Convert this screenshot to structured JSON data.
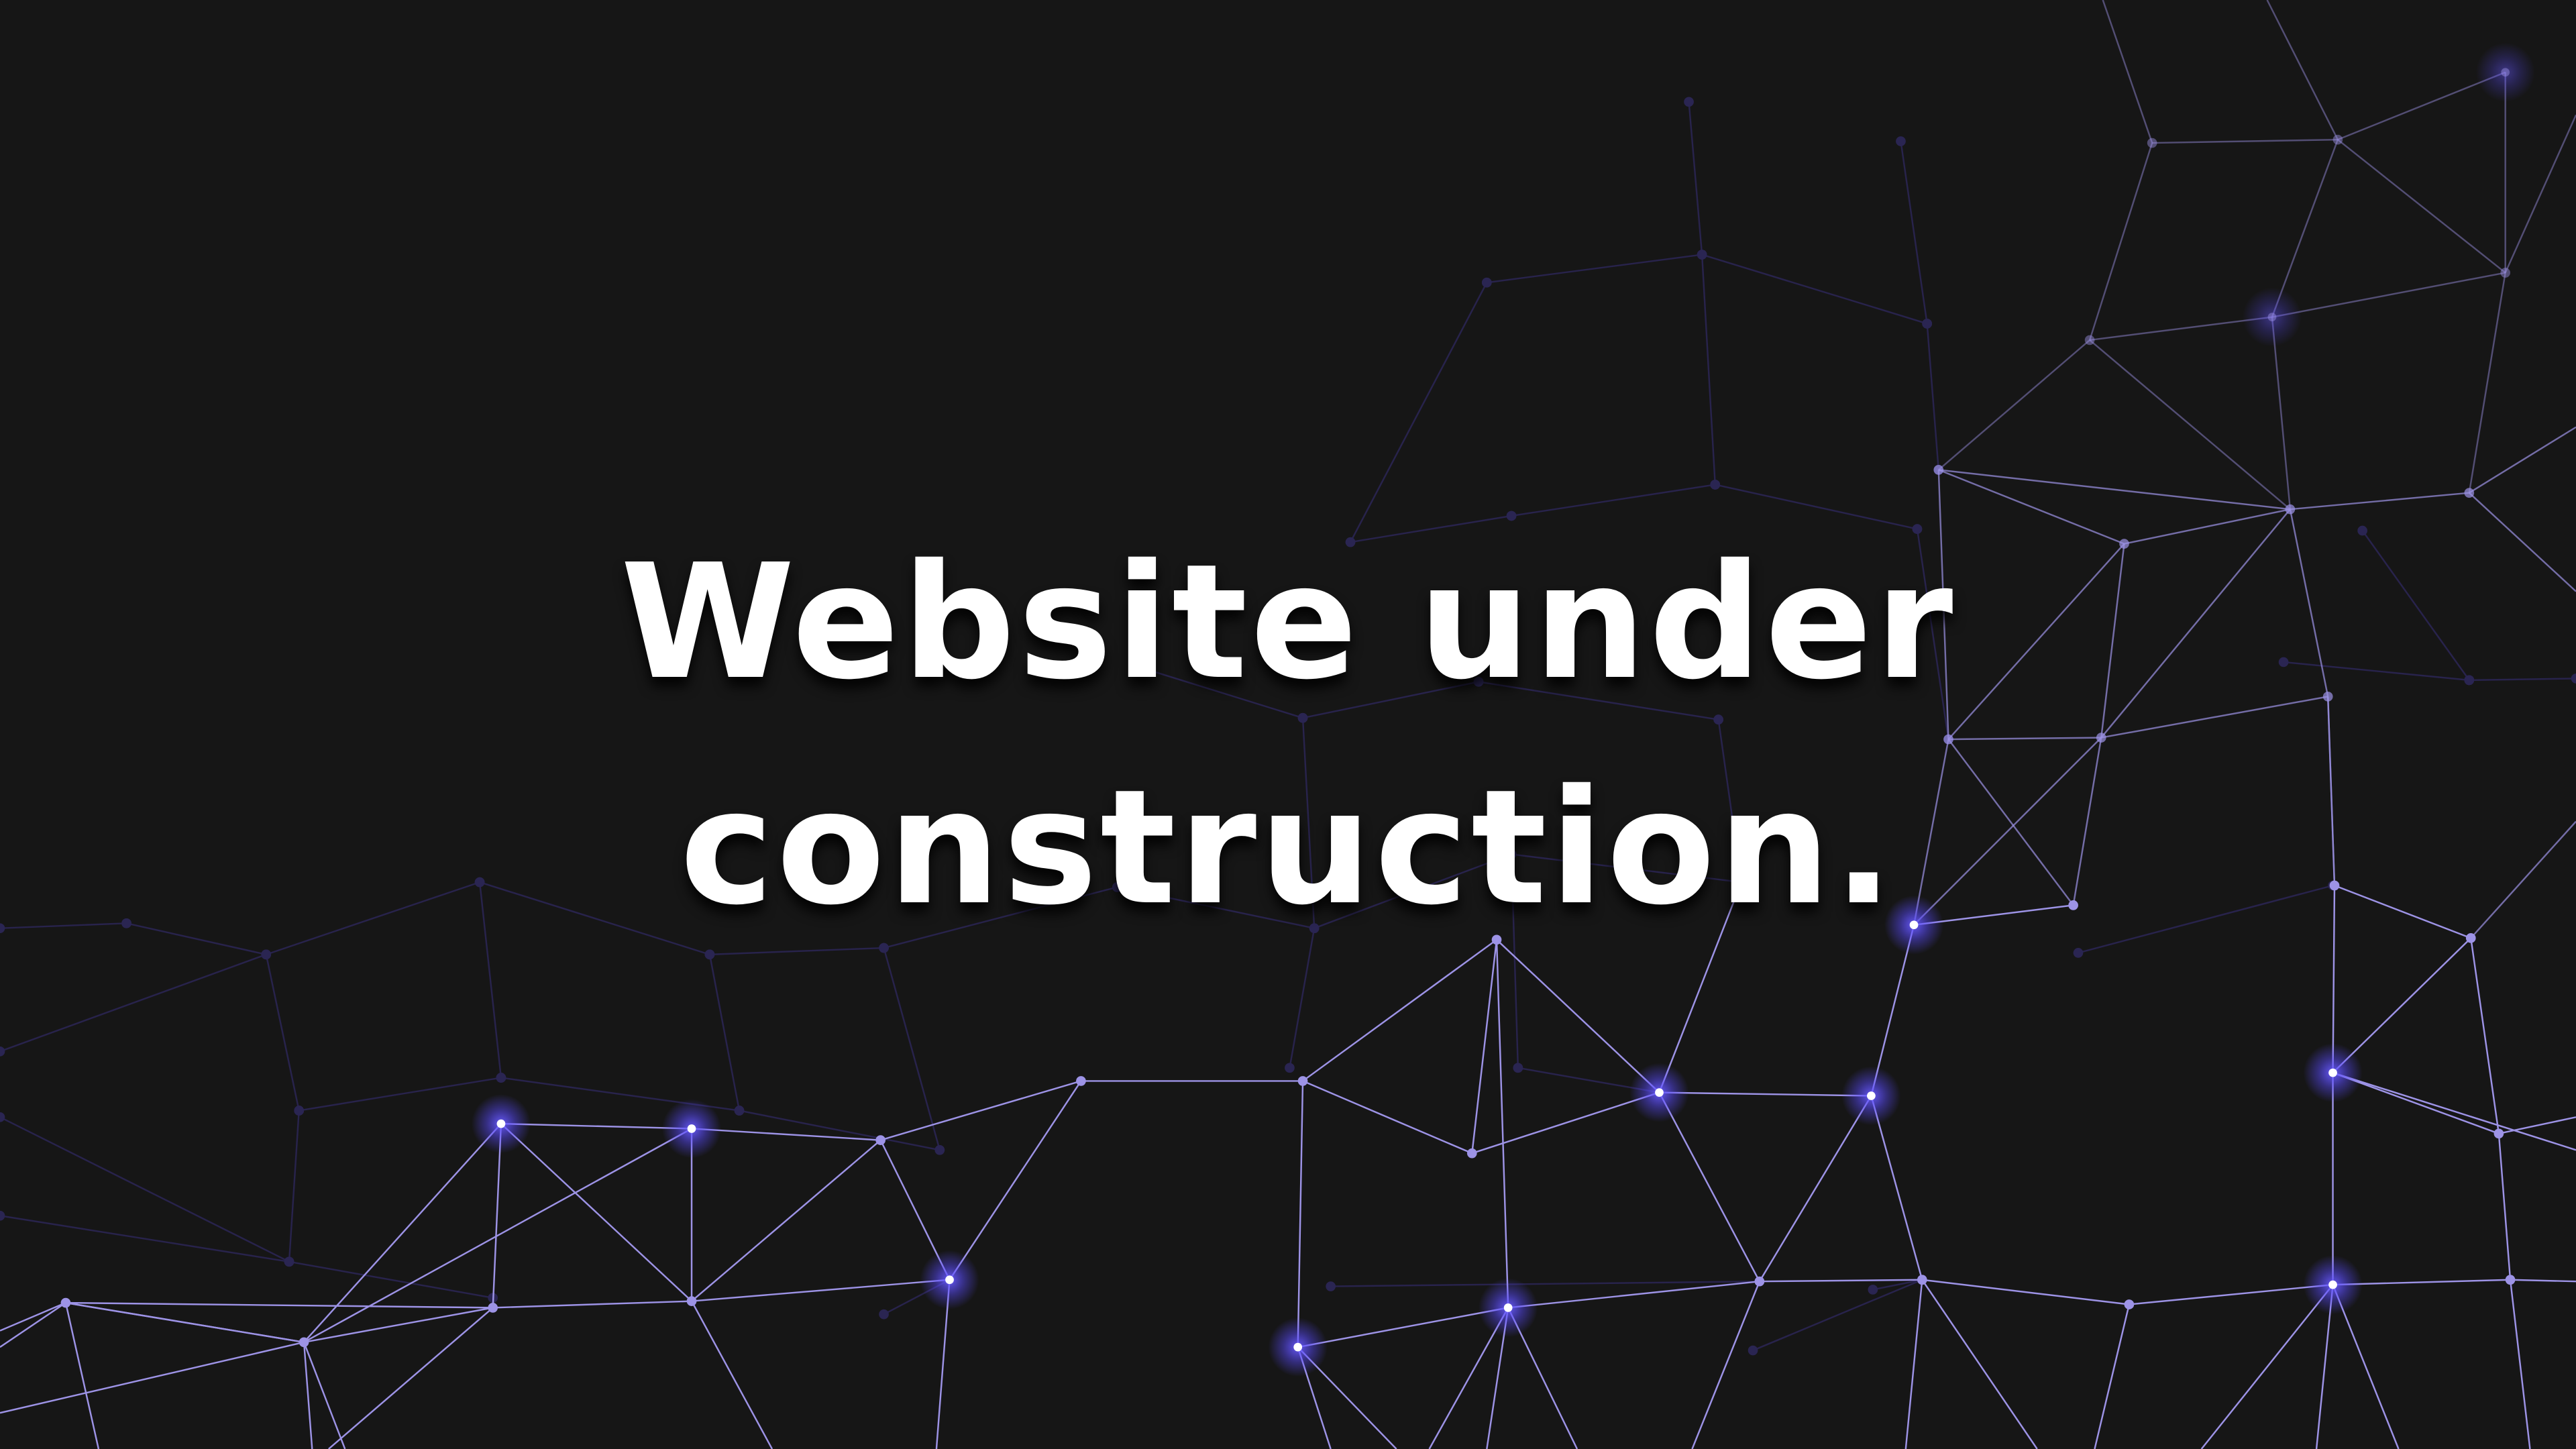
{
  "headline": {
    "line1": "Website under",
    "line2": "construction."
  },
  "colors": {
    "background": "#161616",
    "edge_bright": "#9d93e6",
    "edge_dim": "#2a2552",
    "glow": "#5a4bff",
    "text": "#ffffff"
  }
}
